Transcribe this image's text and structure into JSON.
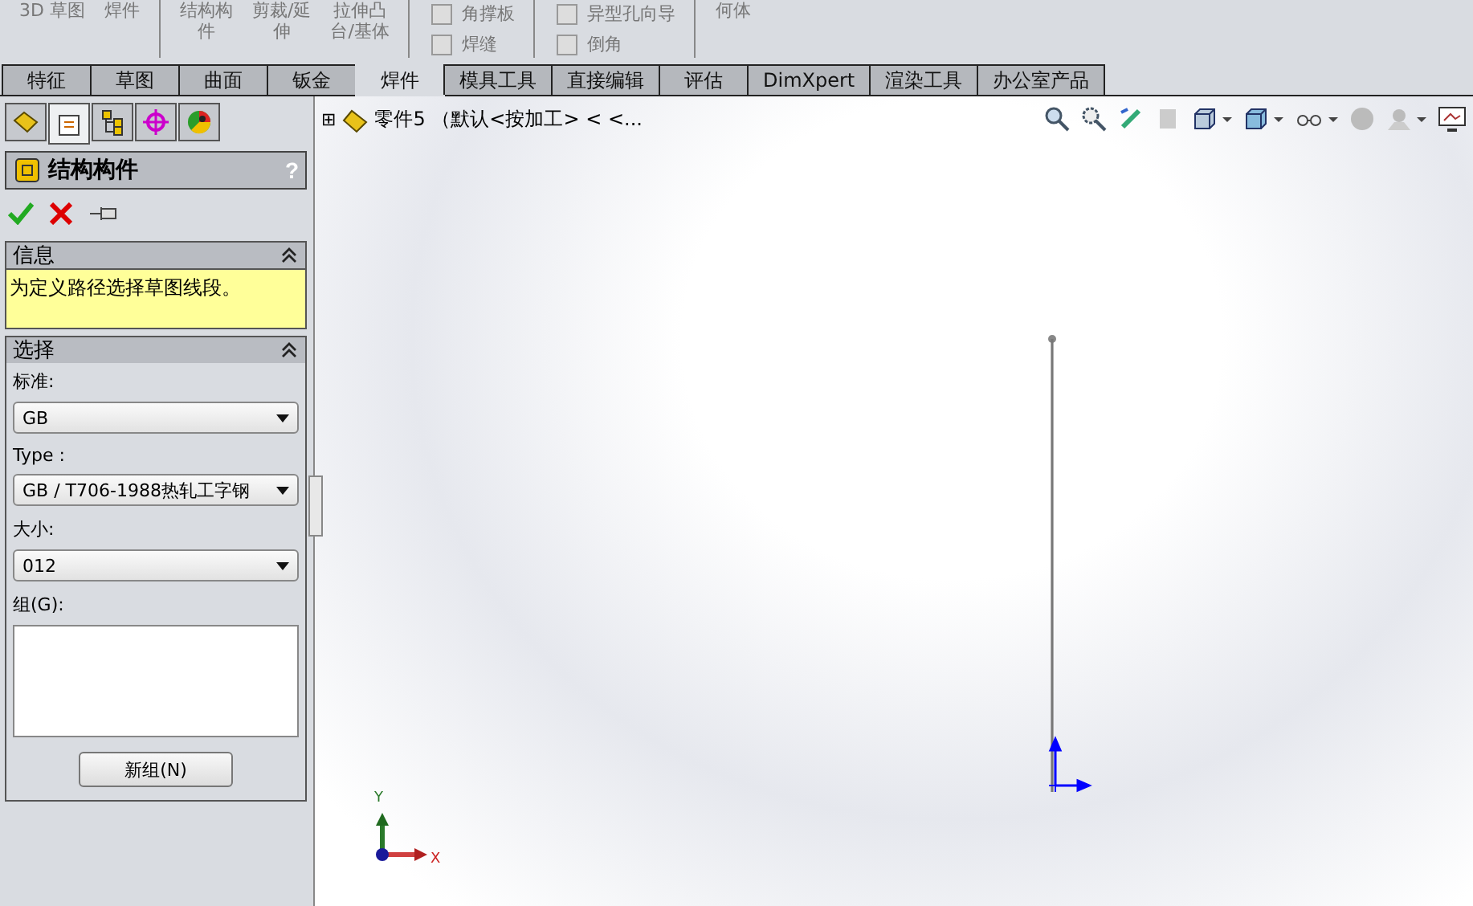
{
  "ribbon": [
    {
      "kind": "big",
      "labels": [
        "3D 草图"
      ]
    },
    {
      "kind": "big",
      "labels": [
        "焊件"
      ]
    },
    {
      "kind": "sep"
    },
    {
      "kind": "big",
      "labels": [
        "结构构",
        "件"
      ]
    },
    {
      "kind": "big",
      "labels": [
        "剪裁/延",
        "伸"
      ]
    },
    {
      "kind": "big",
      "labels": [
        "拉伸凸",
        "台/基体"
      ]
    },
    {
      "kind": "sep"
    },
    {
      "kind": "small",
      "labels": [
        "角撑板",
        "焊缝"
      ]
    },
    {
      "kind": "sep"
    },
    {
      "kind": "small",
      "labels": [
        "异型孔向导",
        "倒角"
      ]
    },
    {
      "kind": "sep"
    },
    {
      "kind": "big",
      "labels": [
        "何体"
      ]
    }
  ],
  "tabs": [
    {
      "label": "特征",
      "selected": false
    },
    {
      "label": "草图",
      "selected": false
    },
    {
      "label": "曲面",
      "selected": false
    },
    {
      "label": "钣金",
      "selected": false
    },
    {
      "label": "焊件",
      "selected": true
    },
    {
      "label": "模具工具",
      "selected": false
    },
    {
      "label": "直接编辑",
      "selected": false
    },
    {
      "label": "评估",
      "selected": false
    },
    {
      "label": "DimXpert",
      "selected": false
    },
    {
      "label": "渲染工具",
      "selected": false
    },
    {
      "label": "办公室产品",
      "selected": false
    }
  ],
  "panel_tabs": [
    {
      "kind": "feature",
      "selected": false
    },
    {
      "kind": "property",
      "selected": true
    },
    {
      "kind": "config",
      "selected": false
    },
    {
      "kind": "dim",
      "selected": false
    },
    {
      "kind": "display",
      "selected": false
    }
  ],
  "property_manager": {
    "title": "结构构件",
    "help": "?",
    "info": {
      "title": "信息",
      "expanded": true,
      "message": "为定义路径选择草图线段。"
    },
    "selection": {
      "title": "选择",
      "expanded": true,
      "fields": [
        {
          "label": "标准:",
          "value": "GB"
        },
        {
          "label": "Type :",
          "value": "GB / T706-1988热轧工字钢"
        },
        {
          "label": "大小:",
          "value": "012"
        }
      ],
      "group_label": "组(G):",
      "new_group_button": "新组(N)"
    }
  },
  "tree": {
    "expand": "⊞",
    "label": "零件5 （默认<按加工> < <..."
  },
  "axes": {
    "x": "X",
    "y": "Y"
  }
}
